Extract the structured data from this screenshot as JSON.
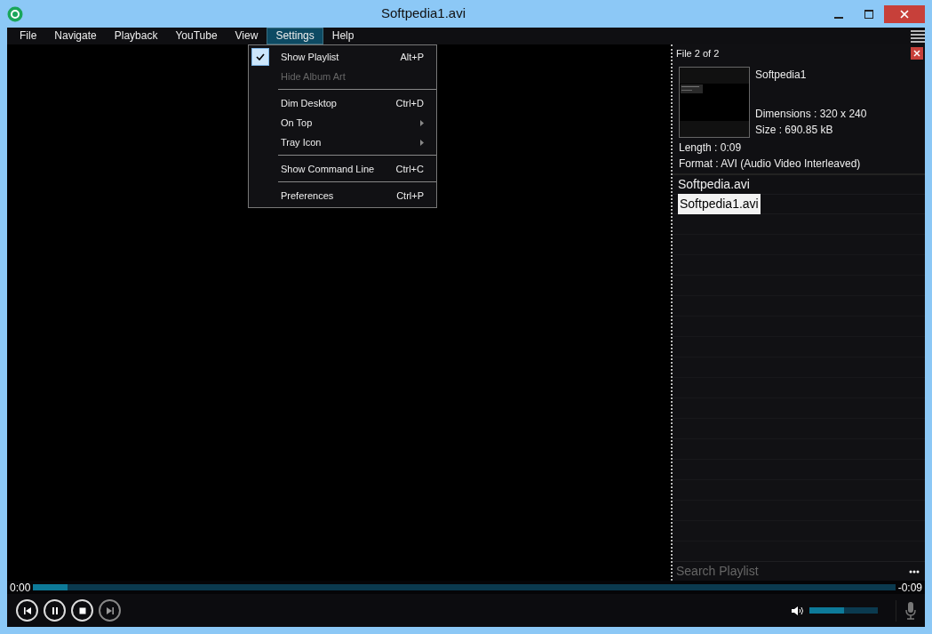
{
  "window": {
    "title": "Softpedia1.avi"
  },
  "menus": [
    {
      "label": "File",
      "selected": false
    },
    {
      "label": "Navigate",
      "selected": false
    },
    {
      "label": "Playback",
      "selected": false
    },
    {
      "label": "YouTube",
      "selected": false
    },
    {
      "label": "View",
      "selected": false
    },
    {
      "label": "Settings",
      "selected": true
    },
    {
      "label": "Help",
      "selected": false
    }
  ],
  "settings_menu": [
    {
      "kind": "item",
      "label": "Show Playlist",
      "shortcut": "Alt+P",
      "checked": true,
      "disabled": false,
      "submenu": false
    },
    {
      "kind": "item",
      "label": "Hide Album Art",
      "checked": false,
      "disabled": true,
      "submenu": false
    },
    {
      "kind": "separator"
    },
    {
      "kind": "item",
      "label": "Dim Desktop",
      "shortcut": "Ctrl+D",
      "checked": false,
      "disabled": false,
      "submenu": false
    },
    {
      "kind": "item",
      "label": "On Top",
      "checked": false,
      "disabled": false,
      "submenu": true
    },
    {
      "kind": "item",
      "label": "Tray Icon",
      "checked": false,
      "disabled": false,
      "submenu": true
    },
    {
      "kind": "separator"
    },
    {
      "kind": "item",
      "label": "Show Command Line",
      "shortcut": "Ctrl+C",
      "checked": false,
      "disabled": false,
      "submenu": false
    },
    {
      "kind": "separator"
    },
    {
      "kind": "item",
      "label": "Preferences",
      "shortcut": "Ctrl+P",
      "checked": false,
      "disabled": false,
      "submenu": false
    }
  ],
  "playlist": {
    "file_counter": "File 2 of 2",
    "info": {
      "title": "Softpedia1",
      "dimensions": "Dimensions : 320 x 240",
      "size": "Size : 690.85 kB",
      "length": "Length : 0:09",
      "format": "Format : AVI (Audio Video Interleaved)"
    },
    "items": [
      {
        "label": "Softpedia.avi",
        "selected": false
      },
      {
        "label": "Softpedia1.avi",
        "selected": true
      }
    ],
    "search": {
      "placeholder": "Search Playlist"
    }
  },
  "seek": {
    "elapsed": "0:00",
    "remaining": "-0:09",
    "level": 0.04
  },
  "controls": [
    {
      "kind": "previous",
      "disabled": false
    },
    {
      "kind": "pause",
      "disabled": false
    },
    {
      "kind": "stop",
      "disabled": false
    },
    {
      "kind": "next",
      "disabled": true
    }
  ],
  "volume": {
    "level": 0.5
  }
}
